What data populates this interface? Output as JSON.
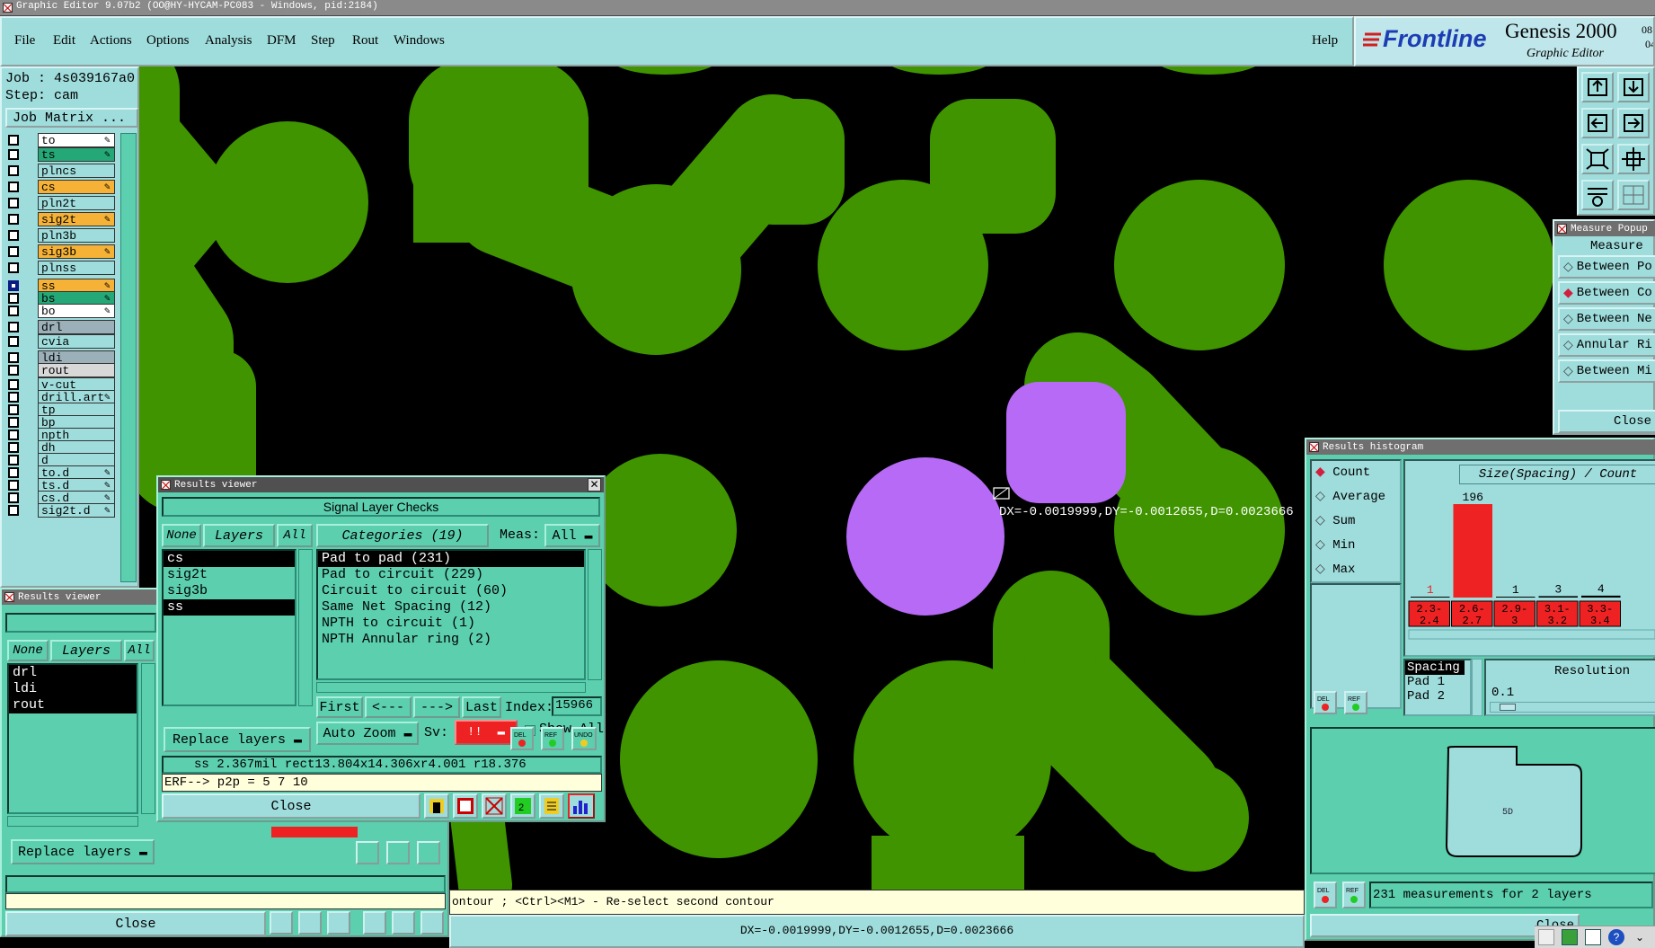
{
  "app": {
    "title_bar": "Graphic Editor 9.07b2 (OO@HY-HYCAM-PC083 - Windows, pid:2184)",
    "menu": [
      "File",
      "Edit",
      "Actions",
      "Options",
      "Analysis",
      "DFM",
      "Step",
      "Rout",
      "Windows"
    ],
    "help": "Help",
    "brand": "Frontline",
    "product": "Genesis 2000",
    "subtitle": "Graphic Editor",
    "version_frag_1": "08",
    "version_frag_2": "04"
  },
  "job": {
    "job_label": "Job : 4s039167a0",
    "step_label": "Step: cam",
    "matrix_button": "Job Matrix ..."
  },
  "layers": [
    {
      "name": "to",
      "color": "#ffffff",
      "mark": true
    },
    {
      "name": "ts",
      "color": "#24a878",
      "mark": true
    },
    {
      "name": "plncs",
      "color": "#9fdcdc",
      "mark": false
    },
    {
      "name": "cs",
      "color": "#f6b236",
      "mark": true
    },
    {
      "name": "pln2t",
      "color": "#9fdcdc",
      "mark": false
    },
    {
      "name": "sig2t",
      "color": "#f6b236",
      "mark": true
    },
    {
      "name": "pln3b",
      "color": "#9fdcdc",
      "mark": false
    },
    {
      "name": "sig3b",
      "color": "#f6b236",
      "mark": true
    },
    {
      "name": "plnss",
      "color": "#9fdcdc",
      "mark": false
    },
    {
      "name": "ss",
      "color": "#f6b236",
      "mark": true
    },
    {
      "name": "bs",
      "color": "#24a878",
      "mark": true
    },
    {
      "name": "bo",
      "color": "#ffffff",
      "mark": true
    },
    {
      "name": "drl",
      "color": "#9bb0b8",
      "mark": false
    },
    {
      "name": "cvia",
      "color": "#9fdcdc",
      "mark": false
    },
    {
      "name": "ldi",
      "color": "#9bb0b8",
      "mark": false
    },
    {
      "name": "rout",
      "color": "#d8d8d8",
      "mark": false
    },
    {
      "name": "v-cut",
      "color": "#9fdcdc",
      "mark": false
    },
    {
      "name": "drill.art",
      "color": "#9fdcdc",
      "mark": true
    },
    {
      "name": "tp",
      "color": "#9fdcdc",
      "mark": false
    },
    {
      "name": "bp",
      "color": "#9fdcdc",
      "mark": false
    },
    {
      "name": "npth",
      "color": "#9fdcdc",
      "mark": false
    },
    {
      "name": "dh",
      "color": "#9fdcdc",
      "mark": false
    },
    {
      "name": "d",
      "color": "#9fdcdc",
      "mark": false
    },
    {
      "name": "to.d",
      "color": "#9fdcdc",
      "mark": true
    },
    {
      "name": "ts.d",
      "color": "#9fdcdc",
      "mark": true
    },
    {
      "name": "cs.d",
      "color": "#9fdcdc",
      "mark": true
    },
    {
      "name": "sig2t.d",
      "color": "#9fdcdc",
      "mark": true
    }
  ],
  "rv_main": {
    "title": "Results viewer",
    "header": "Signal Layer Checks",
    "none": "None",
    "layers": "Layers",
    "all": "All",
    "layer_list": [
      "cs",
      "sig2t",
      "sig3b",
      "ss"
    ],
    "categories": "Categories (19)",
    "meas_label": "Meas:",
    "meas_value": "All",
    "cat_list": [
      "Pad to pad (231)",
      "Pad to circuit (229)",
      "Circuit to circuit (60)",
      "Same Net Spacing (12)",
      "NPTH to circuit (1)",
      "NPTH Annular ring (2)"
    ],
    "first": "First",
    "prev": "<---",
    "next": "--->",
    "last": "Last",
    "index_label": "Index:",
    "index_value": "15966",
    "auto_zoom": "Auto Zoom",
    "sv_label": "Sv:",
    "sv_value": "!!",
    "show_all": "Show All",
    "replace_layers": "Replace layers",
    "info_line": "ss 2.367mil  rect13.804x14.306xr4.001  r18.376",
    "erf_line": "ERF--> p2p = 5 7 10",
    "close": "Close"
  },
  "rv_back": {
    "title": "Results viewer",
    "none": "None",
    "layers": "Layers",
    "all": "All",
    "layer_list": [
      "drl",
      "ldi",
      "rout"
    ],
    "replace_layers": "Replace layers",
    "close": "Close"
  },
  "measure": {
    "title": "Measure Popup",
    "header": "Measure",
    "options": [
      "Between Po",
      "Between Co",
      "Between Ne",
      "Annular Ri",
      "Between Mi"
    ],
    "close": "Close"
  },
  "histogram": {
    "title": "Results histogram",
    "modes": [
      "Count",
      "Average",
      "Sum",
      "Min",
      "Max"
    ],
    "header": "Size(Spacing) / Count",
    "chart_data": {
      "type": "bar",
      "categories": [
        "2.3-2.4",
        "2.6-2.7",
        "2.9-3",
        "3.1-3.2",
        "3.3-3.4"
      ],
      "values": [
        1,
        196,
        1,
        3,
        4
      ],
      "value_labels": [
        "1",
        "196",
        "1",
        "3",
        "4"
      ],
      "tick_top": [
        "2.3-",
        "2.6-",
        "2.9-",
        "3.1-",
        "3.3-"
      ],
      "tick_bottom": [
        "2.4",
        "2.7",
        "3",
        "3.2",
        "3.4"
      ]
    },
    "spacing_list": [
      "Spacing",
      "Pad 1",
      "Pad 2"
    ],
    "resolution_label": "Resolution",
    "resolution_value": "0.1",
    "summary": "231 measurements for 2 layers",
    "close": "Close",
    "zoom_tag": "5D"
  },
  "canvas": {
    "measure_readout": "DX=-0.0019999,DY=-0.0012655,D=0.0023666",
    "prompt": "ontour ; <Ctrl><M1> - Re-select second contour",
    "status": "DX=-0.0019999,DY=-0.0012655,D=0.0023666"
  },
  "colors": {
    "copper": "#3f9400",
    "highlight": "#b66af5",
    "panel": "#9fdcdc",
    "list": "#5ccfae",
    "alert": "#ee2222"
  }
}
